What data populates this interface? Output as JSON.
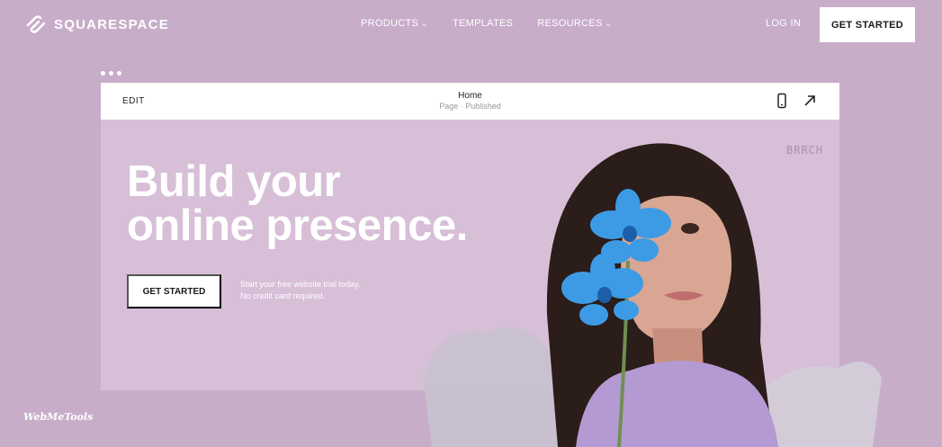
{
  "nav": {
    "brand": "SQUARESPACE",
    "items": [
      {
        "label": "PRODUCTS",
        "has_dropdown": true
      },
      {
        "label": "TEMPLATES",
        "has_dropdown": false
      },
      {
        "label": "RESOURCES",
        "has_dropdown": true
      }
    ],
    "login": "LOG IN",
    "cta": "GET STARTED"
  },
  "editor": {
    "edit_label": "EDIT",
    "page_title": "Home",
    "page_status": "Page · Published",
    "icons": [
      "mobile-preview-icon",
      "open-external-icon"
    ]
  },
  "hero": {
    "headline_line1": "Build your",
    "headline_line2": "online presence.",
    "cta": "GET STARTED",
    "trial_line1": "Start your free website trial today.",
    "trial_line2": "No credit card required.",
    "brand_mark": "BRRCH"
  },
  "watermark": "WebMeTools",
  "colors": {
    "background": "#c8adc9",
    "editor_canvas": "#d7bfd8",
    "orchid": "#3d9be6"
  }
}
